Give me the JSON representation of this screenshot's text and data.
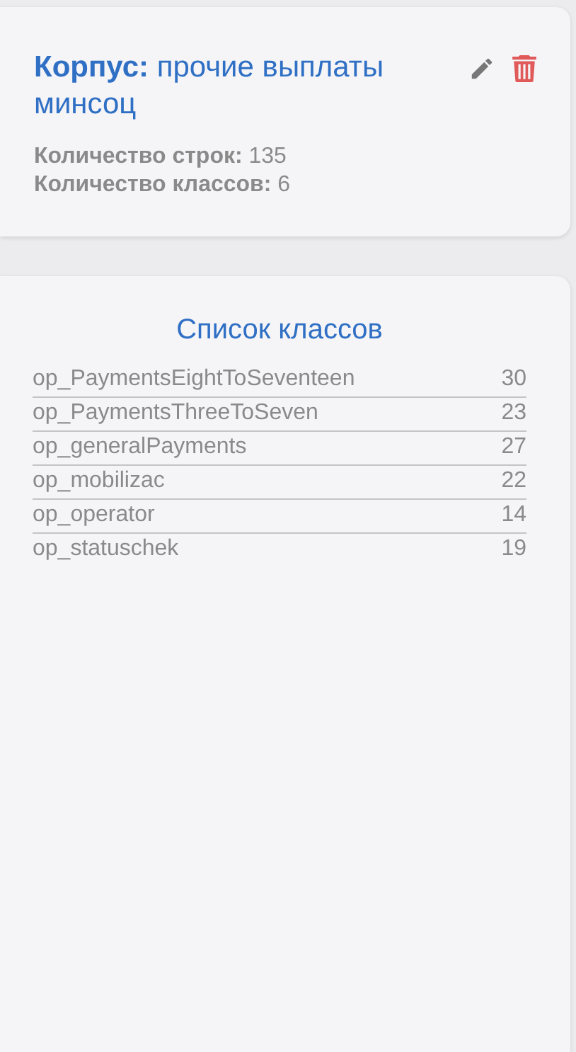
{
  "corpus": {
    "title": "**Корпус:** прочие выплаты минсоц",
    "stats": [
      "**Количество строк:** 135",
      "**Количество классов:** 6"
    ]
  },
  "class_list": {
    "title": "Список классов",
    "rows": [
      {
        "name": "op_PaymentsEightToSeventeen",
        "count": "30"
      },
      {
        "name": "op_PaymentsThreeToSeven",
        "count": "23"
      },
      {
        "name": "op_generalPayments",
        "count": "27"
      },
      {
        "name": "op_mobilizac",
        "count": "22"
      },
      {
        "name": "op_operator",
        "count": "14"
      },
      {
        "name": "op_statuschek",
        "count": "19"
      }
    ]
  }
}
